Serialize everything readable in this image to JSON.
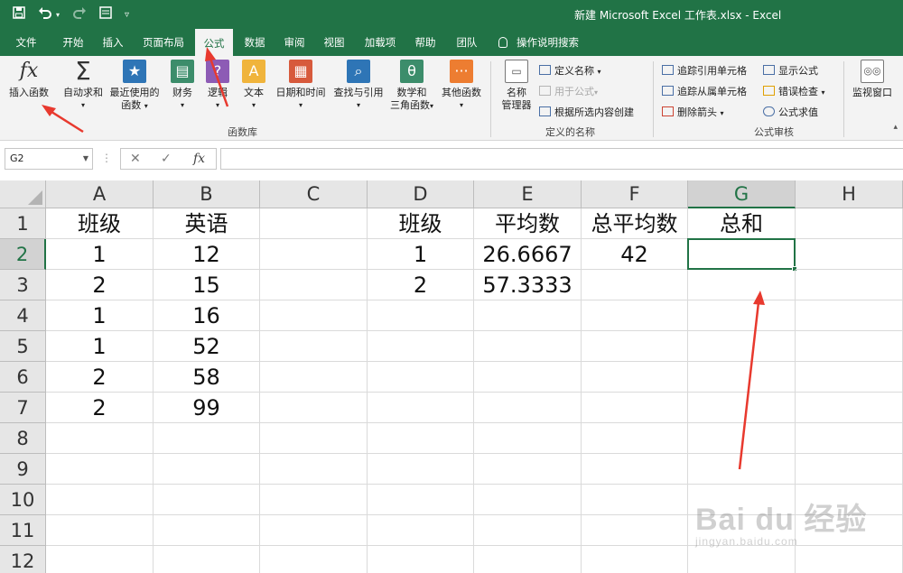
{
  "titlebar": {
    "title": "新建 Microsoft Excel 工作表.xlsx  -  Excel",
    "colors": {
      "brand": "#217346"
    }
  },
  "qat": {
    "icons": [
      "save-icon",
      "undo-icon",
      "redo-icon",
      "form-icon",
      "customize-icon"
    ]
  },
  "tabs": {
    "items": [
      "文件",
      "开始",
      "插入",
      "页面布局",
      "公式",
      "数据",
      "审阅",
      "视图",
      "加载项",
      "帮助",
      "团队"
    ],
    "active": "公式",
    "tell_me": "操作说明搜索"
  },
  "ribbon": {
    "function_library": {
      "label": "函数库",
      "insert_function": "插入函数",
      "autosum": "自动求和",
      "recent_1": "最近使用的",
      "recent_2": "函数",
      "financial": "财务",
      "logical": "逻辑",
      "text": "文本",
      "datetime": "日期和时间",
      "lookup": "查找与引用",
      "math_1": "数学和",
      "math_2": "三角函数",
      "more": "其他函数"
    },
    "defined_names": {
      "label": "定义的名称",
      "manager_1": "名称",
      "manager_2": "管理器",
      "define_name": "定义名称",
      "use_in_formula": "用于公式",
      "create_from_selection": "根据所选内容创建"
    },
    "auditing": {
      "label": "公式审核",
      "trace_precedents": "追踪引用单元格",
      "trace_dependents": "追踪从属单元格",
      "remove_arrows": "删除箭头",
      "show_formulas": "显示公式",
      "error_checking": "错误检查",
      "evaluate_formula": "公式求值"
    },
    "watch_window": "监视窗口"
  },
  "formula_bar": {
    "name_box": "G2",
    "cancel": "✕",
    "enter": "✓",
    "fx": "fx",
    "content": ""
  },
  "grid": {
    "columns": [
      "A",
      "B",
      "C",
      "D",
      "E",
      "F",
      "G",
      "H"
    ],
    "rows": [
      "1",
      "2",
      "3",
      "4",
      "5",
      "6",
      "7",
      "8",
      "9",
      "10",
      "11",
      "12"
    ],
    "selected_cell": "G2",
    "cells": {
      "A1": "班级",
      "B1": "英语",
      "D1": "班级",
      "E1": "平均数",
      "F1": "总平均数",
      "G1": "总和",
      "A2": "1",
      "B2": "12",
      "D2": "1",
      "E2": "26.6667",
      "F2": "42",
      "G2": "",
      "A3": "2",
      "B3": "15",
      "D3": "2",
      "E3": "57.3333",
      "A4": "1",
      "B4": "16",
      "A5": "1",
      "B5": "52",
      "A6": "2",
      "B6": "58",
      "A7": "2",
      "B7": "99"
    }
  },
  "watermark": {
    "logo": "Bai du 经验",
    "url": "jingyan.baidu.com"
  }
}
